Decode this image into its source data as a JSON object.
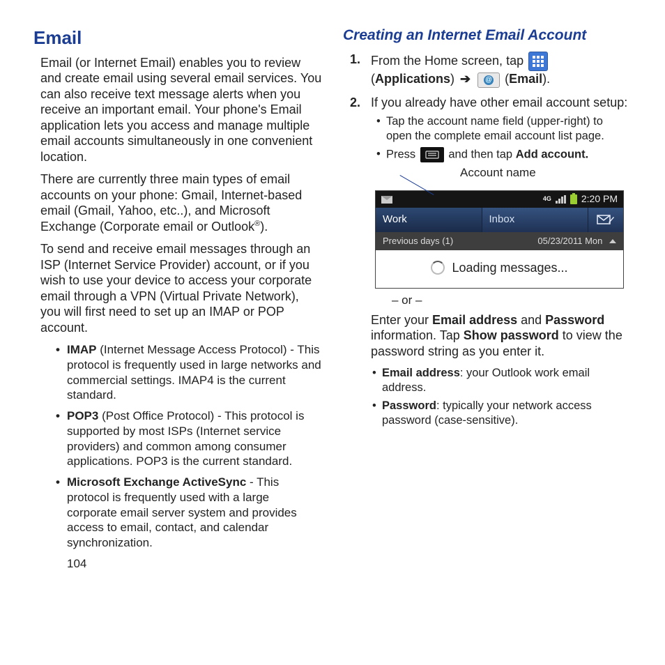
{
  "left": {
    "title": "Email",
    "p1": "Email (or Internet Email) enables you to review and create email using several email services. You can also receive text message alerts when you receive an important email. Your phone's Email application lets you access and manage multiple email accounts simultaneously in one convenient location.",
    "p2_pre": "There are currently three main types of email accounts on your phone: Gmail, Internet-based email (Gmail, Yahoo, etc..), and Microsoft Exchange (Corporate email or Outlook",
    "p2_sup": "®",
    "p2_post": ").",
    "p3": "To send and receive email messages through an ISP (Internet Service Provider) account, or if you wish to use your device to access your corporate email through a VPN (Virtual Private Network), you will first need to set up an IMAP or POP account.",
    "protocols": {
      "imap_b": "IMAP",
      "imap_rest": " (Internet Message Access Protocol) - This protocol is frequently used in large networks and commercial settings. IMAP4 is the current standard.",
      "pop3_b": "POP3",
      "pop3_rest": " (Post Office Protocol) - This protocol is supported by most ISPs (Internet service providers) and common among consumer applications. POP3 is the current standard.",
      "eas_b": "Microsoft Exchange ActiveSync",
      "eas_rest": " - This protocol is frequently used with a large corporate email server system and provides access to email, contact, and calendar synchronization."
    }
  },
  "right": {
    "subtitle": "Creating an Internet Email Account",
    "step1_pre": "From the Home screen, tap ",
    "step1_apps": "Applications",
    "step1_email": "Email",
    "step2_text": "If you already have other email account setup:",
    "step2_bul1": "Tap the account name field (upper-right) to open the complete email account list page.",
    "step2_bul2_pre": "Press ",
    "step2_bul2_mid": " and then tap ",
    "step2_bul2_bold": "Add account.",
    "callout_label": "Account name",
    "shot": {
      "time": "2:20 PM",
      "net": "4G",
      "tab_account": "Work",
      "tab_inbox": "Inbox",
      "prev_days": "Previous days (1)",
      "date": "05/23/2011 Mon",
      "loading": "Loading messages..."
    },
    "or_text": "– or –",
    "enter_p_pre": "Enter your ",
    "enter_p_b1": "Email address",
    "enter_p_mid1": " and ",
    "enter_p_b2": "Password",
    "enter_p_mid2": " information. Tap ",
    "enter_p_b3": "Show password",
    "enter_p_post": " to view the password string as you enter it.",
    "defs": {
      "email_b": "Email address",
      "email_rest": ": your Outlook work email address.",
      "pwd_b": "Password",
      "pwd_rest": ": typically your network access password (case-sensitive)."
    }
  },
  "page_number": "104"
}
